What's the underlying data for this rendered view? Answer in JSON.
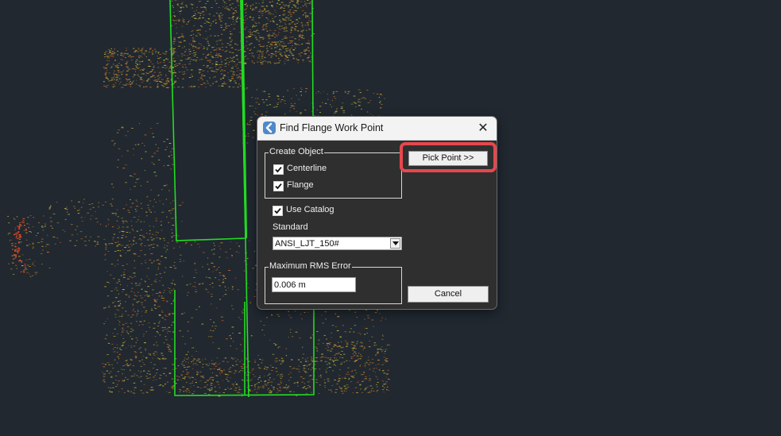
{
  "dialog": {
    "title": "Find Flange Work Point",
    "close_glyph": "✕",
    "create_object": {
      "label": "Create Object",
      "centerline": {
        "label": "Centerline",
        "checked": true
      },
      "flange": {
        "label": "Flange",
        "checked": true
      }
    },
    "use_catalog": {
      "label": "Use Catalog",
      "checked": true
    },
    "standard": {
      "label": "Standard",
      "selected": "ANSI_LJT_150#"
    },
    "max_rms_error": {
      "label": "Maximum RMS Error",
      "value": "0.006 m"
    },
    "buttons": {
      "pick_point": "Pick Point >>",
      "cancel": "Cancel"
    }
  },
  "icons": {
    "app": "app-logo-icon",
    "close": "close-icon",
    "check": "check-icon",
    "dropdown": "chevron-down-icon"
  },
  "colors": {
    "background": "#212830",
    "outline_green": "#22dd22",
    "highlight_red": "#e5484d",
    "dialog_body": "#2f2f2f"
  }
}
